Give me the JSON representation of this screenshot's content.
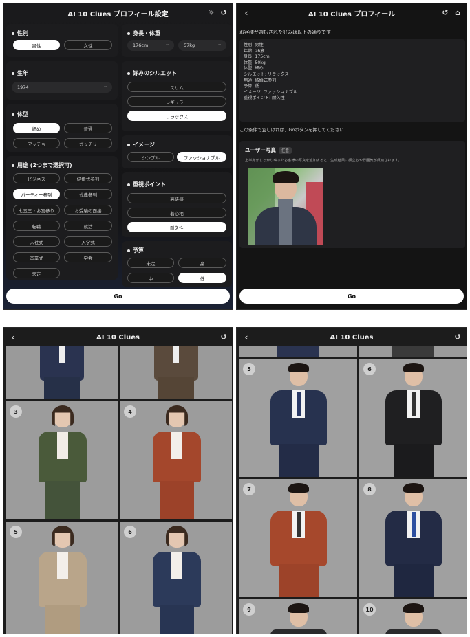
{
  "panel1": {
    "title": "AI 10 Clues プロフィール設定",
    "gender": {
      "label": "性別",
      "options": [
        "男性",
        "女性"
      ]
    },
    "height_weight": {
      "label": "身長・体重",
      "height": "176cm",
      "weight": "57kg"
    },
    "birth_year": {
      "label": "生年",
      "value": "1974"
    },
    "body_type": {
      "label": "体型",
      "options": [
        "細め",
        "普通",
        "マッチョ",
        "ガッチリ"
      ]
    },
    "silhouette": {
      "label": "好みのシルエット",
      "options": [
        "スリム",
        "レギュラー",
        "リラックス"
      ]
    },
    "image": {
      "label": "イメージ",
      "options": [
        "シンプル",
        "ファッショナブル"
      ]
    },
    "usage": {
      "label": "用途 (2つまで選択可)",
      "options": [
        "ビジネス",
        "結婚式参列",
        "パーティー参列",
        "式典参列",
        "七五三・お宮参り",
        "お受験の面接",
        "転職",
        "就活",
        "入社式",
        "入学式",
        "卒業式",
        "学会",
        "未定"
      ]
    },
    "priority": {
      "label": "重視ポイント",
      "options": [
        "高級感",
        "着心地",
        "耐久性"
      ]
    },
    "budget": {
      "label": "予算",
      "options": [
        "未定",
        "高",
        "中",
        "低"
      ]
    },
    "go": "Go"
  },
  "panel2": {
    "title": "AI 10 Clues プロフィール",
    "heading": "お客様が選択された好みは以下の通りです",
    "summary": [
      "性別: 男性",
      "年齢: 26歳",
      "身長: 175cm",
      "体重: 50kg",
      "体型: 細め",
      "シルエット: リラックス",
      "用途: 結婚式参列",
      "予算: 低",
      "イメージ: ファッショナブル",
      "重視ポイント: 耐久性"
    ],
    "note": "この条件で宜しければ、Goボタンを押してください",
    "photo_title": "ユーザー写真",
    "photo_tag": "任意",
    "photo_desc": "上半身がしっかり映ったお客様の写真を追加すると、生成結果に顔立ちや雰囲気が反映されます。",
    "go": "Go"
  },
  "panel3": {
    "title": "AI 10 Clues",
    "tiles": [
      "3",
      "4",
      "5",
      "6"
    ]
  },
  "panel4": {
    "title": "AI 10 Clues",
    "tiles": [
      "5",
      "6",
      "7",
      "8",
      "9",
      "10"
    ]
  },
  "icons": {
    "back": "chevron-left-icon",
    "history": "history-icon",
    "settings": "gear-icon",
    "home": "home-icon"
  },
  "colors": {
    "background": "#141414",
    "card": "#1c1c1e",
    "selected": "#ffffff"
  }
}
